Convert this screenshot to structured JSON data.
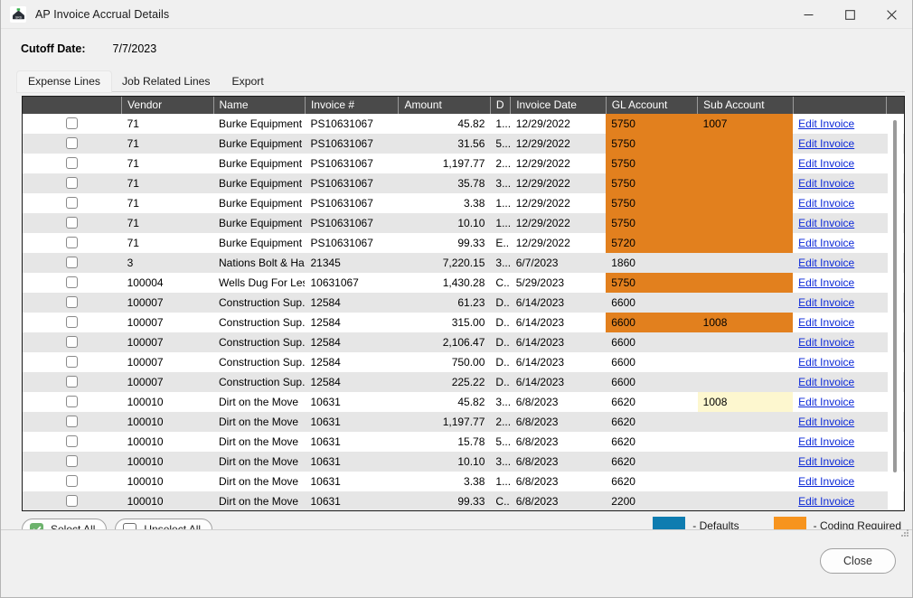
{
  "window": {
    "title": "AP Invoice Accrual Details",
    "icon": "app-logo-icon",
    "minimize": "—",
    "maximize": "☐",
    "close": "✕"
  },
  "header": {
    "cutoff_label": "Cutoff Date:",
    "cutoff_value": "7/7/2023"
  },
  "tabs": [
    {
      "label": "Expense Lines",
      "active": true
    },
    {
      "label": "Job Related Lines",
      "active": false
    },
    {
      "label": "Export",
      "active": false
    }
  ],
  "grid": {
    "columns": [
      {
        "key": "check",
        "label": ""
      },
      {
        "key": "vendor",
        "label": "Vendor"
      },
      {
        "key": "name",
        "label": "Name"
      },
      {
        "key": "invoice",
        "label": "Invoice #"
      },
      {
        "key": "amount",
        "label": "Amount"
      },
      {
        "key": "d",
        "label": "D"
      },
      {
        "key": "date",
        "label": "Invoice Date"
      },
      {
        "key": "gl",
        "label": "GL Account"
      },
      {
        "key": "sub",
        "label": "Sub Account"
      },
      {
        "key": "action",
        "label": ""
      },
      {
        "key": "spare",
        "label": ""
      }
    ],
    "edit_link_label": "Edit Invoice",
    "rows": [
      {
        "checked": false,
        "vendor": "71",
        "name": "Burke Equipment ...",
        "invoice": "PS10631067",
        "amount": "45.82",
        "d": "1...",
        "date": "12/29/2022",
        "gl": "5750",
        "sub": "1007",
        "gl_hl": "orange",
        "sub_hl": "orange"
      },
      {
        "checked": false,
        "vendor": "71",
        "name": "Burke Equipment ...",
        "invoice": "PS10631067",
        "amount": "31.56",
        "d": "5...",
        "date": "12/29/2022",
        "gl": "5750",
        "sub": "",
        "gl_hl": "orange",
        "sub_hl": "orange"
      },
      {
        "checked": false,
        "vendor": "71",
        "name": "Burke Equipment ...",
        "invoice": "PS10631067",
        "amount": "1,197.77",
        "d": "2...",
        "date": "12/29/2022",
        "gl": "5750",
        "sub": "",
        "gl_hl": "orange",
        "sub_hl": "orange"
      },
      {
        "checked": false,
        "vendor": "71",
        "name": "Burke Equipment ...",
        "invoice": "PS10631067",
        "amount": "35.78",
        "d": "3...",
        "date": "12/29/2022",
        "gl": "5750",
        "sub": "",
        "gl_hl": "orange",
        "sub_hl": "orange"
      },
      {
        "checked": false,
        "vendor": "71",
        "name": "Burke Equipment ...",
        "invoice": "PS10631067",
        "amount": "3.38",
        "d": "1...",
        "date": "12/29/2022",
        "gl": "5750",
        "sub": "",
        "gl_hl": "orange",
        "sub_hl": "orange"
      },
      {
        "checked": false,
        "vendor": "71",
        "name": "Burke Equipment ...",
        "invoice": "PS10631067",
        "amount": "10.10",
        "d": "1...",
        "date": "12/29/2022",
        "gl": "5750",
        "sub": "",
        "gl_hl": "orange",
        "sub_hl": "orange"
      },
      {
        "checked": false,
        "vendor": "71",
        "name": "Burke Equipment ...",
        "invoice": "PS10631067",
        "amount": "99.33",
        "d": "E..",
        "date": "12/29/2022",
        "gl": "5720",
        "sub": "",
        "gl_hl": "orange",
        "sub_hl": "orange"
      },
      {
        "checked": false,
        "vendor": "3",
        "name": "Nations Bolt & Ha...",
        "invoice": "21345",
        "amount": "7,220.15",
        "d": "3...",
        "date": "6/7/2023",
        "gl": "1860",
        "sub": "",
        "gl_hl": "none",
        "sub_hl": "none"
      },
      {
        "checked": false,
        "vendor": "100004",
        "name": "Wells Dug For Less",
        "invoice": "10631067",
        "amount": "1,430.28",
        "d": "C..",
        "date": "5/29/2023",
        "gl": "5750",
        "sub": "",
        "gl_hl": "orange",
        "sub_hl": "orange"
      },
      {
        "checked": false,
        "vendor": "100007",
        "name": "Construction Sup...",
        "invoice": "12584",
        "amount": "61.23",
        "d": "D..",
        "date": "6/14/2023",
        "gl": "6600",
        "sub": "",
        "gl_hl": "none",
        "sub_hl": "none"
      },
      {
        "checked": false,
        "vendor": "100007",
        "name": "Construction Sup...",
        "invoice": "12584",
        "amount": "315.00",
        "d": "D..",
        "date": "6/14/2023",
        "gl": "6600",
        "sub": "1008",
        "gl_hl": "orange",
        "sub_hl": "orange"
      },
      {
        "checked": false,
        "vendor": "100007",
        "name": "Construction Sup...",
        "invoice": "12584",
        "amount": "2,106.47",
        "d": "D..",
        "date": "6/14/2023",
        "gl": "6600",
        "sub": "",
        "gl_hl": "none",
        "sub_hl": "none"
      },
      {
        "checked": false,
        "vendor": "100007",
        "name": "Construction Sup...",
        "invoice": "12584",
        "amount": "750.00",
        "d": "D..",
        "date": "6/14/2023",
        "gl": "6600",
        "sub": "",
        "gl_hl": "none",
        "sub_hl": "none"
      },
      {
        "checked": false,
        "vendor": "100007",
        "name": "Construction Sup...",
        "invoice": "12584",
        "amount": "225.22",
        "d": "D..",
        "date": "6/14/2023",
        "gl": "6600",
        "sub": "",
        "gl_hl": "none",
        "sub_hl": "none"
      },
      {
        "checked": false,
        "vendor": "100010",
        "name": "Dirt on the Move",
        "invoice": "10631",
        "amount": "45.82",
        "d": "3...",
        "date": "6/8/2023",
        "gl": "6620",
        "sub": "1008",
        "gl_hl": "none",
        "sub_hl": "yellow"
      },
      {
        "checked": false,
        "vendor": "100010",
        "name": "Dirt on the Move",
        "invoice": "10631",
        "amount": "1,197.77",
        "d": "2...",
        "date": "6/8/2023",
        "gl": "6620",
        "sub": "",
        "gl_hl": "none",
        "sub_hl": "none"
      },
      {
        "checked": false,
        "vendor": "100010",
        "name": "Dirt on the Move",
        "invoice": "10631",
        "amount": "15.78",
        "d": "5...",
        "date": "6/8/2023",
        "gl": "6620",
        "sub": "",
        "gl_hl": "none",
        "sub_hl": "none"
      },
      {
        "checked": false,
        "vendor": "100010",
        "name": "Dirt on the Move",
        "invoice": "10631",
        "amount": "10.10",
        "d": "3...",
        "date": "6/8/2023",
        "gl": "6620",
        "sub": "",
        "gl_hl": "none",
        "sub_hl": "none"
      },
      {
        "checked": false,
        "vendor": "100010",
        "name": "Dirt on the Move",
        "invoice": "10631",
        "amount": "3.38",
        "d": "1...",
        "date": "6/8/2023",
        "gl": "6620",
        "sub": "",
        "gl_hl": "none",
        "sub_hl": "none"
      },
      {
        "checked": false,
        "vendor": "100010",
        "name": "Dirt on the Move",
        "invoice": "10631",
        "amount": "99.33",
        "d": "C..",
        "date": "6/8/2023",
        "gl": "2200",
        "sub": "",
        "gl_hl": "none",
        "sub_hl": "none"
      }
    ]
  },
  "footer": {
    "select_all_label": "Select All",
    "unselect_all_label": "Unselect All",
    "legend": [
      {
        "color": "#0e7cb0",
        "label": "- Defaults"
      },
      {
        "color": "#f7941e",
        "label": "- Coding Required"
      }
    ],
    "close_label": "Close"
  },
  "colors": {
    "coding_required": "#e2801e",
    "defaults": "#0e7cb0",
    "link": "#0b28d8",
    "header_bg": "#4a4a4a",
    "row_alt": "#e6e6e6",
    "sub_highlight": "#fdf7cf"
  }
}
